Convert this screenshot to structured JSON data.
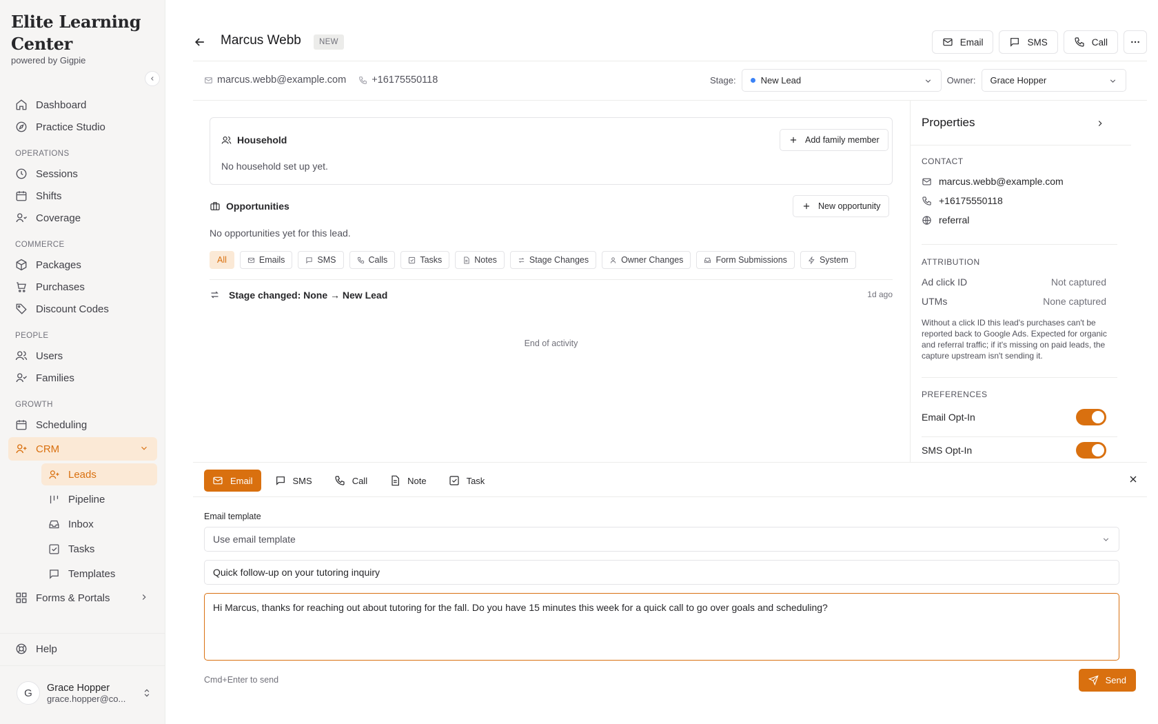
{
  "brand": {
    "name": "Elite Learning Center",
    "powered_by": "powered by Gigpie"
  },
  "sidebar": {
    "top_items": [
      {
        "label": "Dashboard",
        "icon": "home-icon"
      },
      {
        "label": "Practice Studio",
        "icon": "compass-icon"
      }
    ],
    "sections": [
      {
        "label": "OPERATIONS",
        "items": [
          "Sessions",
          "Shifts",
          "Coverage"
        ]
      },
      {
        "label": "COMMERCE",
        "items": [
          "Packages",
          "Purchases",
          "Discount Codes"
        ]
      },
      {
        "label": "PEOPLE",
        "items": [
          "Users",
          "Families"
        ]
      },
      {
        "label": "GROWTH",
        "items": [
          "Scheduling",
          "CRM"
        ]
      }
    ],
    "crm_sub": [
      "Leads",
      "Pipeline",
      "Inbox",
      "Tasks",
      "Templates"
    ],
    "forms_portals": "Forms & Portals",
    "help": "Help",
    "user": {
      "initial": "G",
      "name": "Grace Hopper",
      "email": "grace.hopper@co..."
    }
  },
  "header": {
    "lead_name": "Marcus Webb",
    "badge": "NEW",
    "actions": {
      "email": "Email",
      "sms": "SMS",
      "call": "Call"
    }
  },
  "contact": {
    "email": "marcus.webb@example.com",
    "phone": "+16175550118"
  },
  "stage": {
    "label": "Stage:",
    "value": "New Lead",
    "dot_color": "#3b82f6"
  },
  "owner": {
    "label": "Owner:",
    "value": "Grace Hopper"
  },
  "household": {
    "title": "Household",
    "button": "Add family member",
    "empty": "No household set up yet."
  },
  "opportunities": {
    "title": "Opportunities",
    "button": "New opportunity",
    "empty": "No opportunities yet for this lead."
  },
  "filters": [
    "All",
    "Emails",
    "SMS",
    "Calls",
    "Tasks",
    "Notes",
    "Stage Changes",
    "Owner Changes",
    "Form Submissions",
    "System"
  ],
  "activity": {
    "text": "Stage changed: None → New Lead",
    "time": "1d ago",
    "end": "End of activity"
  },
  "properties": {
    "title": "Properties",
    "contact_label": "CONTACT",
    "email": "marcus.webb@example.com",
    "phone": "+16175550118",
    "source": "referral",
    "attribution_label": "ATTRIBUTION",
    "ad_click_id_k": "Ad click ID",
    "ad_click_id_v": "Not captured",
    "utms_k": "UTMs",
    "utms_v": "None captured",
    "note": "Without a click ID this lead's purchases can't be reported back to Google Ads. Expected for organic and referral traffic; if it's missing on paid leads, the capture upstream isn't sending it.",
    "preferences_label": "PREFERENCES",
    "email_optin": "Email Opt-In",
    "sms_optin": "SMS Opt-In",
    "email_optin_on": true,
    "sms_optin_on": true
  },
  "composer": {
    "tabs": [
      "Email",
      "SMS",
      "Call",
      "Note",
      "Task"
    ],
    "template_label": "Email template",
    "template_placeholder": "Use email template",
    "subject": "Quick follow-up on your tutoring inquiry",
    "body": "Hi Marcus, thanks for reaching out about tutoring for the fall. Do you have 15 minutes this week for a quick call to go over goals and scheduling?",
    "hint": "Cmd+Enter to send",
    "send": "Send"
  },
  "colors": {
    "accent": "#d9700f",
    "accent_soft": "#fbe9d6"
  }
}
